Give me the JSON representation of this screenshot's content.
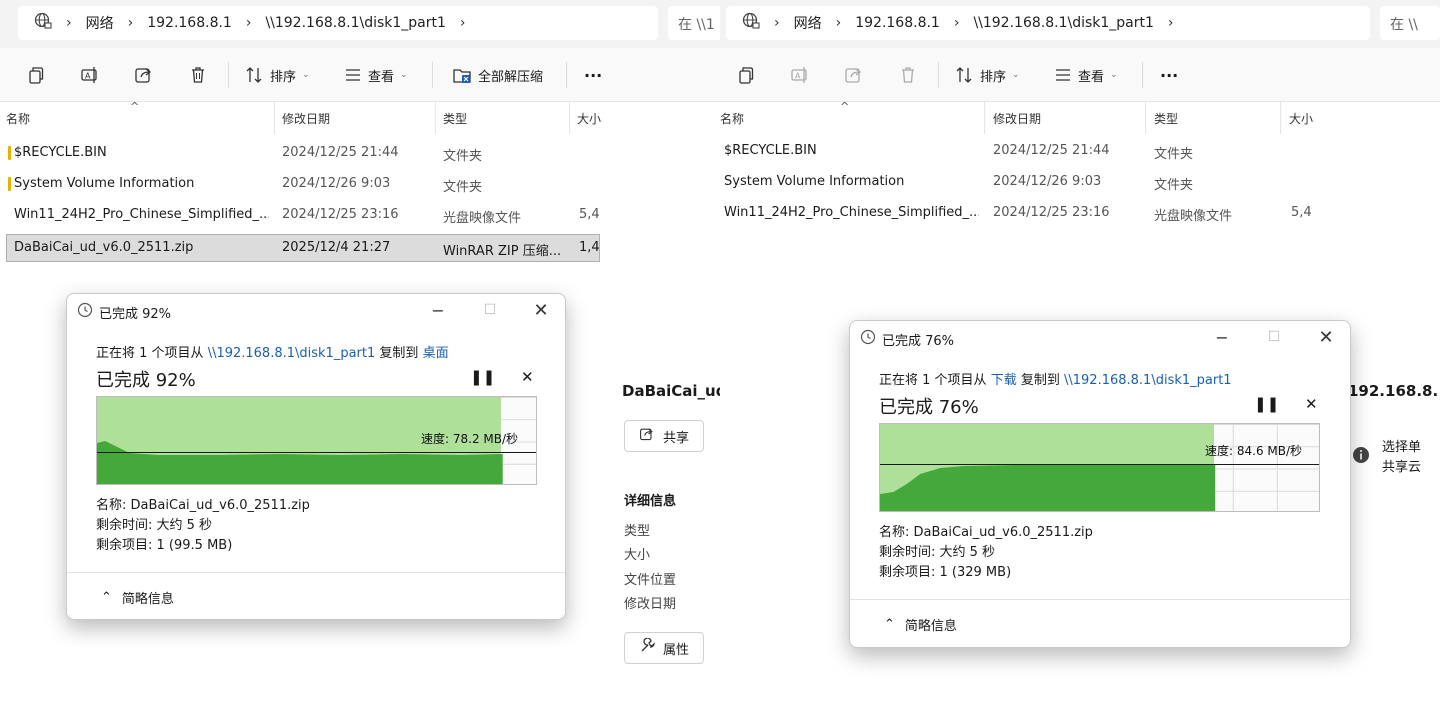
{
  "left": {
    "breadcrumb": [
      "网络",
      "192.168.8.1",
      "\\\\192.168.8.1\\disk1_part1"
    ],
    "search_placeholder": "在 \\\\1",
    "toolbar": {
      "sort": "排序",
      "view": "查看",
      "extract_all": "全部解压缩",
      "more": "···"
    },
    "columns": [
      "名称",
      "修改日期",
      "类型",
      "大小"
    ],
    "files": [
      {
        "name": "$RECYCLE.BIN",
        "date": "2024/12/25 21:44",
        "type": "文件夹",
        "size": ""
      },
      {
        "name": "System Volume Information",
        "date": "2024/12/26 9:03",
        "type": "文件夹",
        "size": ""
      },
      {
        "name": "Win11_24H2_Pro_Chinese_Simplified_...",
        "date": "2024/12/25 23:16",
        "type": "光盘映像文件",
        "size": "5,4"
      },
      {
        "name": "DaBaiCai_ud_v6.0_2511.zip",
        "date": "2025/12/4 21:27",
        "type": "WinRAR ZIP 压缩...",
        "size": "1,4"
      }
    ],
    "details": {
      "title": "DaBaiCai_ud",
      "share": "共享",
      "section": "详细信息",
      "fields": [
        "类型",
        "大小",
        "文件位置",
        "修改日期"
      ],
      "properties": "属性"
    },
    "dialog": {
      "title": "已完成 92%",
      "desc_prefix": "正在将 1 个项目从",
      "source": "\\\\192.168.8.1\\disk1_part1",
      "desc_mid": "复制到",
      "dest": "桌面",
      "percent_text": "已完成 92%",
      "progress": 0.92,
      "speed": "速度: 78.2 MB/秒",
      "name_line": "名称: DaBaiCai_ud_v6.0_2511.zip",
      "time_line": "剩余时间: 大约 5 秒",
      "items_line": "剩余项目: 1 (99.5 MB)",
      "less_info": "简略信息"
    }
  },
  "right": {
    "breadcrumb": [
      "网络",
      "192.168.8.1",
      "\\\\192.168.8.1\\disk1_part1"
    ],
    "search_placeholder": "在 \\\\",
    "toolbar": {
      "sort": "排序",
      "view": "查看",
      "more": "···"
    },
    "columns": [
      "名称",
      "修改日期",
      "类型",
      "大小"
    ],
    "files": [
      {
        "name": "$RECYCLE.BIN",
        "date": "2024/12/25 21:44",
        "type": "文件夹",
        "size": ""
      },
      {
        "name": "System Volume Information",
        "date": "2024/12/26 9:03",
        "type": "文件夹",
        "size": ""
      },
      {
        "name": "Win11_24H2_Pro_Chinese_Simplified_...",
        "date": "2024/12/25 23:16",
        "type": "光盘映像文件",
        "size": "5,4"
      }
    ],
    "details": {
      "title": "192.168.8.",
      "info_line1": "选择单",
      "info_line2": "共享云"
    },
    "dialog": {
      "title": "已完成 76%",
      "desc_prefix": "正在将 1 个项目从",
      "source": "下载",
      "desc_mid": "复制到",
      "dest": "\\\\192.168.8.1\\disk1_part1",
      "percent_text": "已完成 76%",
      "progress": 0.76,
      "speed": "速度: 84.6 MB/秒",
      "name_line": "名称: DaBaiCai_ud_v6.0_2511.zip",
      "time_line": "剩余时间: 大约 5 秒",
      "items_line": "剩余项目: 1 (329 MB)",
      "less_info": "简略信息"
    }
  },
  "colors": {
    "progress_fill": "#aee09a",
    "speed_fill": "#45a83a",
    "link": "#1a5fb4"
  }
}
